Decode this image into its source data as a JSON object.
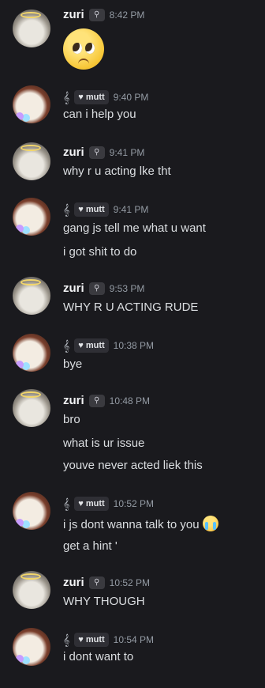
{
  "users": {
    "zuri": {
      "name": "zuri"
    },
    "mutt": {
      "tag": "mutt"
    }
  },
  "messages": [
    {
      "author": "zuri",
      "time": "8:42 PM",
      "lines": [],
      "emoji": "pleading-face"
    },
    {
      "author": "mutt",
      "time": "9:40 PM",
      "lines": [
        "can i help you"
      ]
    },
    {
      "author": "zuri",
      "time": "9:41 PM",
      "lines": [
        "why r u acting lke tht"
      ]
    },
    {
      "author": "mutt",
      "time": "9:41 PM",
      "lines": [
        "gang js tell me what u want",
        "i got shit to do"
      ]
    },
    {
      "author": "zuri",
      "time": "9:53 PM",
      "lines": [
        "WHY R U ACTING RUDE"
      ]
    },
    {
      "author": "mutt",
      "time": "10:38 PM",
      "lines": [
        "bye"
      ]
    },
    {
      "author": "zuri",
      "time": "10:48 PM",
      "lines": [
        "bro",
        "what is ur issue",
        "youve never acted liek this"
      ]
    },
    {
      "author": "mutt",
      "time": "10:52 PM",
      "lines": [
        "i js dont wanna talk to you",
        "get a hint '"
      ],
      "trailing_emoji": "loudly-crying-face"
    },
    {
      "author": "zuri",
      "time": "10:52 PM",
      "lines": [
        "WHY THOUGH"
      ]
    },
    {
      "author": "mutt",
      "time": "10:54 PM",
      "lines": [
        "i dont want to"
      ]
    }
  ]
}
